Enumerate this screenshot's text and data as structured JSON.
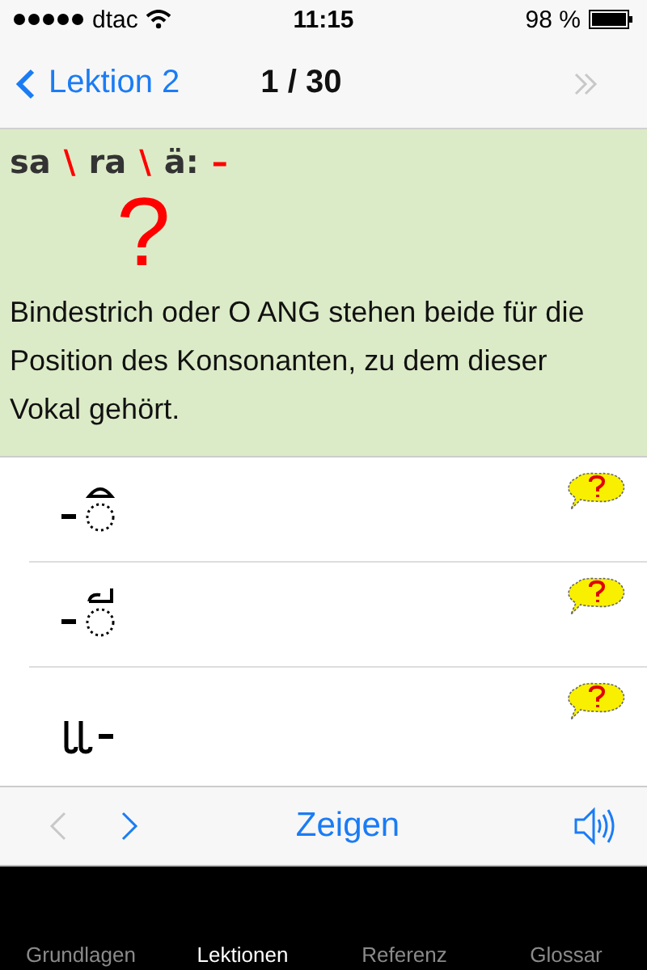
{
  "status_bar": {
    "carrier": "dtac",
    "time": "11:15",
    "battery": "98 %"
  },
  "nav": {
    "back": "Lektion 2",
    "title": "1 / 30",
    "forward_disabled": true
  },
  "card": {
    "heading": [
      {
        "text": "sa",
        "color": "#333333"
      },
      {
        "text": "\\",
        "color": "#ff0000"
      },
      {
        "text": "ra",
        "color": "#333333"
      },
      {
        "text": "\\",
        "color": "#ff0000"
      },
      {
        "text": "ä:",
        "color": "#333333"
      },
      {
        "text": "–",
        "color": "#ff0000"
      }
    ],
    "mark": "?",
    "text": "Bindestrich oder O ANG stehen beide für die Position des Konsonanten, zu dem dieser Vokal gehört."
  },
  "rows": [
    {
      "kind": "hat"
    },
    {
      "kind": "flag"
    },
    {
      "kind": "hooks"
    }
  ],
  "toolbar": {
    "prev_disabled": true,
    "next_disabled": false,
    "show": "Zeigen"
  },
  "tabs": [
    {
      "label": "Grundlagen",
      "selected": false
    },
    {
      "label": "Lektionen",
      "selected": true
    },
    {
      "label": "Referenz",
      "selected": false
    },
    {
      "label": "Glossar",
      "selected": false
    }
  ]
}
